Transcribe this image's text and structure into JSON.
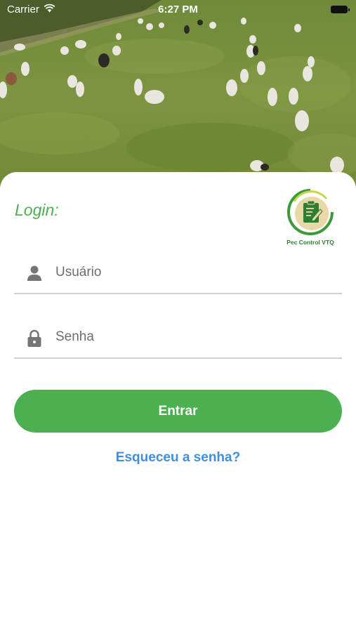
{
  "status_bar": {
    "carrier": "Carrier",
    "time": "6:27 PM",
    "wifi_icon": "wifi-icon",
    "battery_icon": "battery-icon"
  },
  "hero": {
    "icon": "pasture-with-cattle-photo"
  },
  "login": {
    "title": "Login:",
    "logo": {
      "icon": "clipboard-pencil-logo",
      "name": "Pec Control VTQ"
    },
    "username": {
      "icon": "person-icon",
      "placeholder": "Usuário",
      "value": ""
    },
    "password": {
      "icon": "lock-icon",
      "placeholder": "Senha",
      "value": ""
    },
    "submit_label": "Entrar",
    "forgot_label": "Esqueceu a senha?"
  },
  "colors": {
    "primary_green": "#4caf50",
    "link_blue": "#3e8fe0",
    "divider": "#cfcfcf",
    "grass": "#7a8f3a"
  }
}
